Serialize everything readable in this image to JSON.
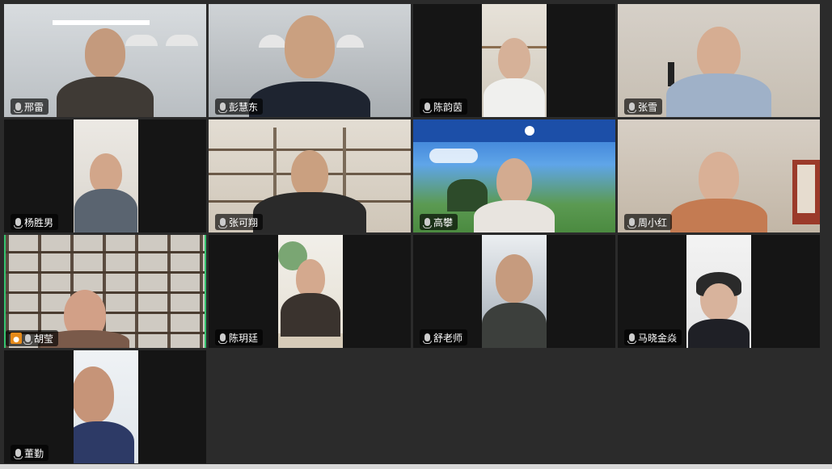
{
  "participants": [
    {
      "name": "邢雷"
    },
    {
      "name": "彭慧东"
    },
    {
      "name": "陈韵茵"
    },
    {
      "name": "张雪"
    },
    {
      "name": "杨胜男"
    },
    {
      "name": "张可翔"
    },
    {
      "name": "高攀"
    },
    {
      "name": "周小红"
    },
    {
      "name": "胡莹",
      "active": true
    },
    {
      "name": "陈玥廷"
    },
    {
      "name": "舒老师"
    },
    {
      "name": "马晓金焱"
    },
    {
      "name": "董勤"
    }
  ],
  "icons": {
    "mic": "mic-icon",
    "host": "user-icon"
  },
  "colors": {
    "active_speaker_border": "#35c46f",
    "host_badge": "#e58a1a",
    "grid_bg": "#2b2b2b"
  }
}
